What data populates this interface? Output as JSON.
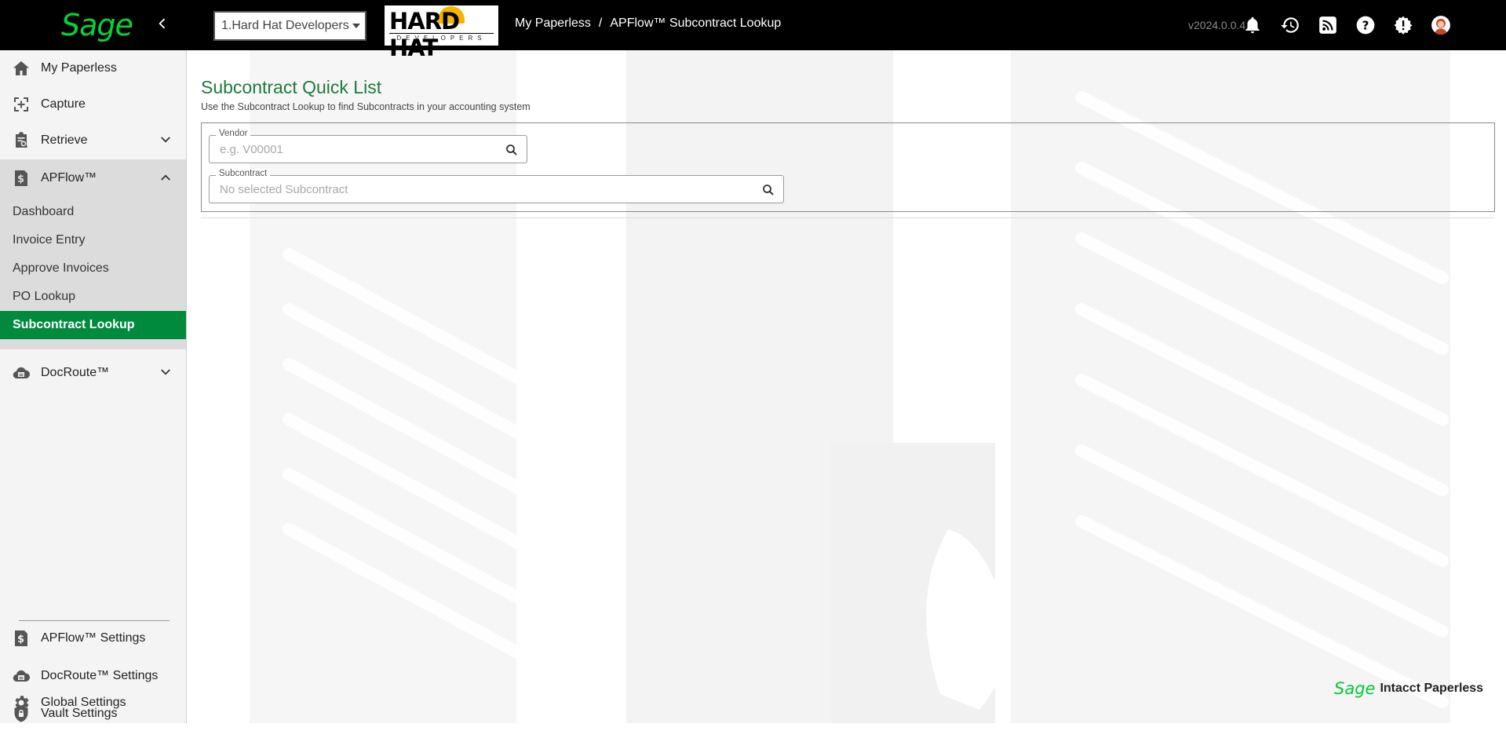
{
  "topbar": {
    "sage_logo": "Sage",
    "collapse_icon": "chevron-left-icon",
    "company_selector": "1.Hard Hat Developers",
    "company_logo_title": "HARD HAT",
    "company_logo_sub": "DEVELOPERS",
    "breadcrumb": [
      "My Paperless",
      "APFlow™ Subcontract Lookup"
    ],
    "breadcrumb_separator": "/",
    "version": "v2024.0.0.4",
    "icons": [
      "bell-icon",
      "history-icon",
      "rss-icon",
      "help-icon",
      "alert-gear-icon",
      "user-avatar-icon"
    ]
  },
  "sidebar": {
    "items": [
      {
        "label": "My Paperless",
        "icon": "home-icon"
      },
      {
        "label": "Capture",
        "icon": "capture-icon"
      },
      {
        "label": "Retrieve",
        "icon": "clipboard-search-icon"
      },
      {
        "label": "APFlow™",
        "icon": "dollar-doc-icon"
      }
    ],
    "apflow_subitems": [
      {
        "label": "Dashboard"
      },
      {
        "label": "Invoice Entry"
      },
      {
        "label": "Approve Invoices"
      },
      {
        "label": "PO Lookup"
      },
      {
        "label": "Subcontract Lookup",
        "active": true
      }
    ],
    "docroute": {
      "label": "DocRoute™",
      "icon": "cloud-doc-icon"
    },
    "settings": [
      {
        "label": "APFlow™ Settings",
        "icon": "dollar-doc-icon"
      },
      {
        "label": "DocRoute™ Settings",
        "icon": "cloud-doc-icon"
      },
      {
        "label": "Vault Settings",
        "icon": "shield-lock-icon"
      },
      {
        "label": "Global Settings",
        "icon": "gear-icon"
      }
    ]
  },
  "main": {
    "title": "Subcontract Quick List",
    "description": "Use the Subcontract Lookup to find Subcontracts in your accounting system",
    "vendor_field": {
      "label": "Vendor",
      "placeholder": "e.g. V00001"
    },
    "subcontract_field": {
      "label": "Subcontract",
      "placeholder": "No selected Subcontract"
    }
  },
  "footer": {
    "brand": "Sage",
    "product": "Intacct Paperless"
  },
  "colors": {
    "accent_green": "#008a3e",
    "title_green": "#1e7a3b",
    "sage_green": "#00d639"
  }
}
